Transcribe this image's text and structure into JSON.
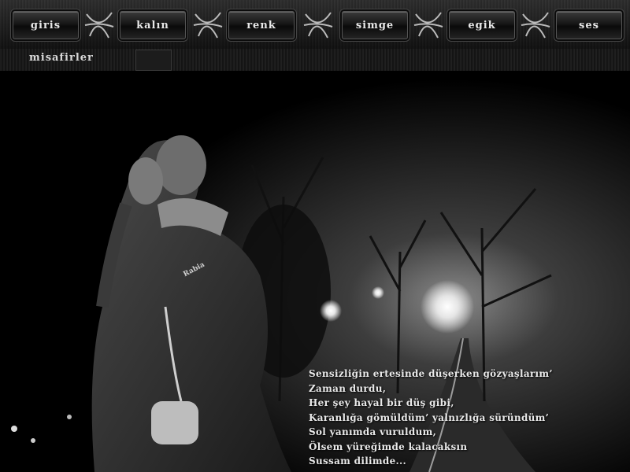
{
  "nav": {
    "items": [
      {
        "label": "giris"
      },
      {
        "label": "kalın"
      },
      {
        "label": "renk"
      },
      {
        "label": "simge"
      },
      {
        "label": "egik"
      },
      {
        "label": "ses"
      }
    ]
  },
  "guests": {
    "label": "misafirler",
    "count": ""
  },
  "photo": {
    "watermark": "Rabia"
  },
  "poem": {
    "lines": [
      "Sensizliğin ertesinde düşerken gözyaşlarım’",
      "Zaman durdu,",
      "Her şey hayal bir düş gibi,",
      "Karanlığa gömüldüm’ yalnızlığa süründüm’",
      "Sol yanımda vuruldum,",
      "Ölsem yüreğimde kalacaksın",
      "Sussam dilimde..."
    ]
  },
  "colors": {
    "background": "#000000",
    "text": "#e9e9e9",
    "button": "#161616"
  }
}
